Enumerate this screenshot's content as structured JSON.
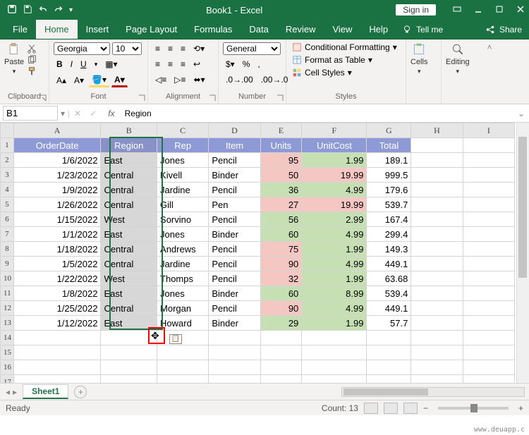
{
  "app": {
    "title": "Book1 - Excel",
    "signin": "Sign in"
  },
  "menu": {
    "tabs": [
      "File",
      "Home",
      "Insert",
      "Page Layout",
      "Formulas",
      "Data",
      "Review",
      "View",
      "Help"
    ],
    "active": 1,
    "tellme": "Tell me",
    "share": "Share"
  },
  "ribbon": {
    "groups": {
      "clipboard": "Clipboard",
      "font": "Font",
      "alignment": "Alignment",
      "number": "Number",
      "styles": "Styles",
      "cells": "Cells",
      "editing": "Editing"
    },
    "paste": "Paste",
    "font_name": "Georgia",
    "font_size": "10",
    "number_format": "General",
    "cond_fmt": "Conditional Formatting",
    "fmt_table": "Format as Table",
    "cell_styles": "Cell Styles",
    "cells_btn": "Cells",
    "editing_btn": "Editing"
  },
  "formula": {
    "cell": "B1",
    "value": "Region"
  },
  "columns": [
    "A",
    "B",
    "C",
    "D",
    "E",
    "F",
    "G",
    "H",
    "I"
  ],
  "chart_data": {
    "type": "table",
    "headers": [
      "OrderDate",
      "Region",
      "Rep",
      "Item",
      "Units",
      "UnitCost",
      "Total"
    ],
    "rows": [
      [
        "1/6/2022",
        "East",
        "Jones",
        "Pencil",
        95,
        1.99,
        189.1
      ],
      [
        "1/23/2022",
        "Central",
        "Kivell",
        "Binder",
        50,
        19.99,
        999.5
      ],
      [
        "1/9/2022",
        "Central",
        "Jardine",
        "Pencil",
        36,
        4.99,
        179.6
      ],
      [
        "1/26/2022",
        "Central",
        "Gill",
        "Pen",
        27,
        19.99,
        539.7
      ],
      [
        "1/15/2022",
        "West",
        "Sorvino",
        "Pencil",
        56,
        2.99,
        167.4
      ],
      [
        "1/1/2022",
        "East",
        "Jones",
        "Binder",
        60,
        4.99,
        299.4
      ],
      [
        "1/18/2022",
        "Central",
        "Andrews",
        "Pencil",
        75,
        1.99,
        149.3
      ],
      [
        "1/5/2022",
        "Central",
        "Jardine",
        "Pencil",
        90,
        4.99,
        449.1
      ],
      [
        "1/22/2022",
        "West",
        "Thomps",
        "Pencil",
        32,
        1.99,
        63.68
      ],
      [
        "1/8/2022",
        "East",
        "Jones",
        "Binder",
        60,
        8.99,
        539.4
      ],
      [
        "1/25/2022",
        "Central",
        "Morgan",
        "Pencil",
        90,
        4.99,
        449.1
      ],
      [
        "1/12/2022",
        "East",
        "Howard",
        "Binder",
        29,
        1.99,
        57.7
      ]
    ],
    "units_color": {
      "pink": [
        95,
        50,
        27,
        75,
        90,
        32,
        90
      ],
      "green": [
        36,
        56,
        60,
        60,
        29
      ]
    },
    "cost_color": {
      "green": [
        1.99,
        4.99,
        2.99,
        4.99,
        1.99,
        4.99,
        1.99,
        8.99,
        4.99,
        1.99
      ],
      "pink": [
        19.99,
        19.99
      ]
    }
  },
  "sheet_tabs": {
    "active": "Sheet1"
  },
  "status": {
    "state": "Ready",
    "count_label": "Count:",
    "count": "13"
  },
  "watermark": "www.deuapp.c"
}
